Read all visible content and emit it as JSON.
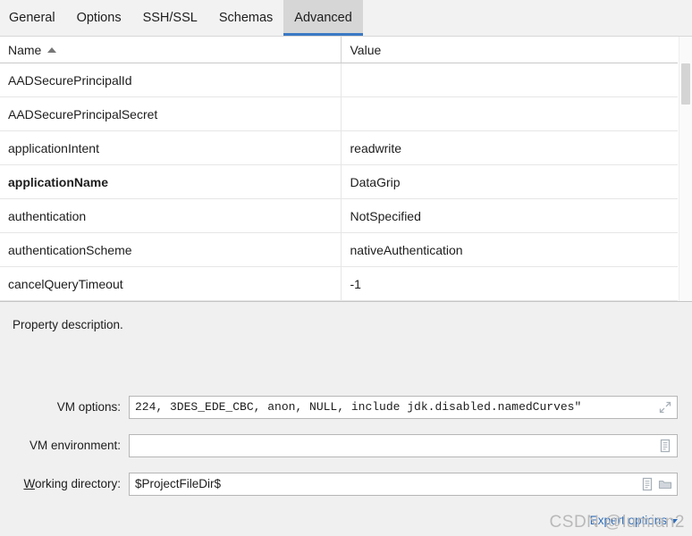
{
  "tabs": [
    {
      "label": "General",
      "selected": false
    },
    {
      "label": "Options",
      "selected": false
    },
    {
      "label": "SSH/SSL",
      "selected": false
    },
    {
      "label": "Schemas",
      "selected": false
    },
    {
      "label": "Advanced",
      "selected": true
    }
  ],
  "accent_color": "#3b78c4",
  "table": {
    "columns": [
      {
        "label": "Name",
        "sort": "ascending"
      },
      {
        "label": "Value",
        "sort": null
      }
    ],
    "rows": [
      {
        "name": "AADSecurePrincipalId",
        "value": "",
        "modified": false
      },
      {
        "name": "AADSecurePrincipalSecret",
        "value": "",
        "modified": false
      },
      {
        "name": "applicationIntent",
        "value": "readwrite",
        "modified": false
      },
      {
        "name": "applicationName",
        "value": "DataGrip",
        "modified": true
      },
      {
        "name": "authentication",
        "value": "NotSpecified",
        "modified": false
      },
      {
        "name": "authenticationScheme",
        "value": "nativeAuthentication",
        "modified": false
      },
      {
        "name": "cancelQueryTimeout",
        "value": "-1",
        "modified": false
      }
    ]
  },
  "description": "Property description.",
  "fields": {
    "vm_options": {
      "label": "VM options:",
      "value": "224, 3DES_EDE_CBC, anon, NULL, include jdk.disabled.namedCurves\"",
      "placeholder": ""
    },
    "vm_environment": {
      "label": "VM environment:",
      "value": "",
      "placeholder": ""
    },
    "working_directory": {
      "label_prefix": "",
      "label_mnemonic": "W",
      "label_suffix": "orking directory:",
      "value": "$ProjectFileDir$",
      "placeholder": ""
    }
  },
  "expert_options": {
    "label": "Expert options"
  },
  "watermark": {
    "text": "CSDN @lumian2"
  }
}
